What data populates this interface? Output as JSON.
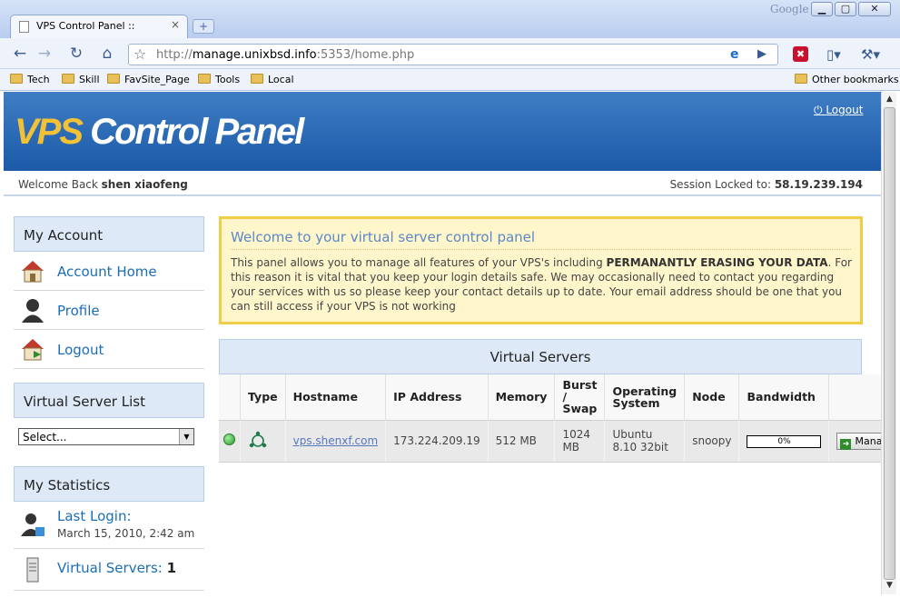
{
  "browser": {
    "tab_title": "VPS Control Panel ::",
    "tab_close": "×",
    "new_tab": "+",
    "brand_label": "Google",
    "url_prefix": "http://",
    "url_host": "manage.unixbsd.info",
    "url_rest": ":5353/home.php",
    "window_minimize": "▁",
    "window_maximize": "▢",
    "window_close": "✕",
    "bookmarks": [
      "Tech",
      "Skill",
      "FavSite_Page",
      "Tools",
      "Local"
    ],
    "other_bookmarks": "Other bookmarks"
  },
  "header": {
    "logo_vps": "VPS",
    "logo_rest": " Control Panel",
    "logout": "Logout"
  },
  "welcome": {
    "prefix": "Welcome Back ",
    "user": "shen xiaofeng",
    "session_label": "Session Locked to: ",
    "session_ip": "58.19.239.194"
  },
  "sidebar": {
    "account_title": "My Account",
    "account_items": [
      "Account Home",
      "Profile",
      "Logout"
    ],
    "vslist_title": "Virtual Server List",
    "select_value": "Select...",
    "stats_title": "My Statistics",
    "last_login_label": "Last Login:",
    "last_login_value": "March 15, 2010, 2:42 am",
    "virtual_servers_label": "Virtual Servers:",
    "virtual_servers_count": "1"
  },
  "notice": {
    "title": "Welcome to your virtual server control panel",
    "text_pre": "This panel allows you to manage all features of your VPS's including ",
    "text_bold": "PERMANANTLY ERASING YOUR DATA",
    "text_post": ". For this reason it is vital that you keep your login details safe. We may occasionally need to contact you regarding your services with us so please keep your contact details up to date. Your email address should be one that you can still access if your VPS is not working"
  },
  "servers": {
    "title": "Virtual Servers",
    "headers": [
      "",
      "Type",
      "Hostname",
      "IP Address",
      "Memory",
      "Burst / Swap",
      "Operating System",
      "Node",
      "Bandwidth",
      ""
    ],
    "row": {
      "hostname": "vps.shenxf.com",
      "ip": "173.224.209.19",
      "memory": "512 MB",
      "burst": "1024 MB",
      "os": "Ubuntu 8.10 32bit",
      "node": "snoopy",
      "bandwidth": "0%",
      "bandwidth_fraction": 0,
      "manage": "Manage"
    }
  },
  "colors": {
    "header_blue": "#1b5aa8",
    "logo_yellow": "#f2c135",
    "link_blue": "#1b6db7",
    "notice_border": "#f1cc47",
    "status_green": "#2a9b2a"
  }
}
